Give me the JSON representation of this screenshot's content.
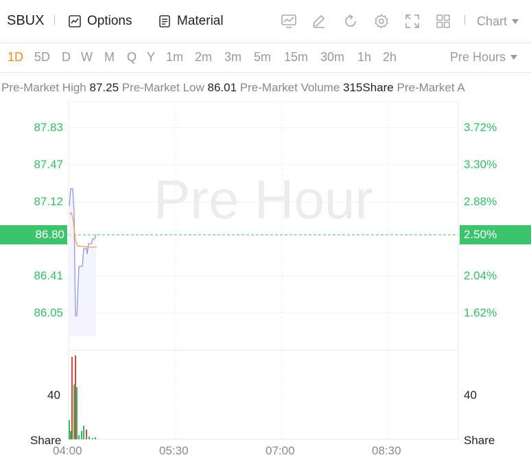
{
  "toolbar": {
    "symbol": "SBUX",
    "options_label": "Options",
    "material_label": "Material",
    "chart_label": "Chart"
  },
  "intervals": {
    "items": [
      "1D",
      "5D",
      "D",
      "W",
      "M",
      "Q",
      "Y",
      "1m",
      "2m",
      "3m",
      "5m",
      "15m",
      "30m",
      "1h",
      "2h"
    ],
    "active": "1D",
    "session_label": "Pre Hours"
  },
  "info": {
    "high_label": "Pre-Market High",
    "high_value": "87.25",
    "low_label": "Pre-Market Low",
    "low_value": "86.01",
    "volume_label": "Pre-Market Volume",
    "volume_value": "315Share",
    "amount_label": "Pre-Market A"
  },
  "chart": {
    "watermark": "Pre Hour",
    "price_ticks": [
      "87.83",
      "87.47",
      "87.12",
      "86.80",
      "86.41",
      "86.05"
    ],
    "percent_ticks": [
      "3.72%",
      "3.30%",
      "2.88%",
      "2.50%",
      "2.04%",
      "1.62%"
    ],
    "current_price": "86.80",
    "current_percent": "2.50%",
    "volume_tick": "40",
    "volume_unit": "Share",
    "time_ticks": [
      "04:00",
      "05:30",
      "07:00",
      "08:30"
    ],
    "colors": {
      "up": "#2fbf62",
      "down": "#e0413a",
      "price_line": "#8f97e6",
      "avg_line": "#f5a04a"
    }
  }
}
